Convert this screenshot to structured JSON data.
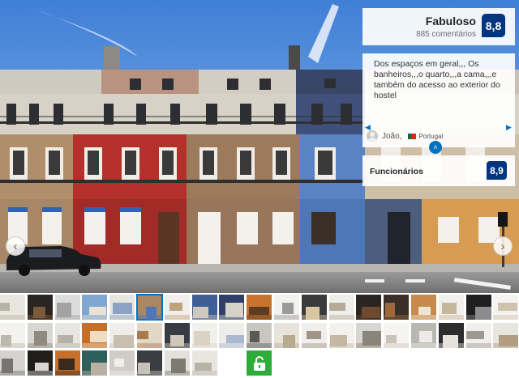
{
  "review": {
    "score_label": "Fabuloso",
    "review_count": "885 comentários",
    "score": "8,8",
    "quote": "Dos espaços em geral,,, Os banheiros,,,o quarto,,,a cama,,,e também do acesso ao exterior do hostel",
    "reviewer_name": "João,",
    "reviewer_country": "Portugal",
    "staff_label": "Funcionários",
    "staff_score": "8,9"
  },
  "gallery": {
    "prev_label": "‹",
    "next_label": "›",
    "expand_label": "˄",
    "thumbnail_count": 46,
    "active_thumbnail": 5,
    "icons": [
      "chevron-left-icon",
      "chevron-right-icon",
      "chevron-up-icon",
      "unlock-icon",
      "user-avatar-icon",
      "portugal-flag-icon"
    ],
    "colors": {
      "accent": "#0071c2",
      "badge": "#003580",
      "lock_tile": "#2dac3a"
    }
  }
}
